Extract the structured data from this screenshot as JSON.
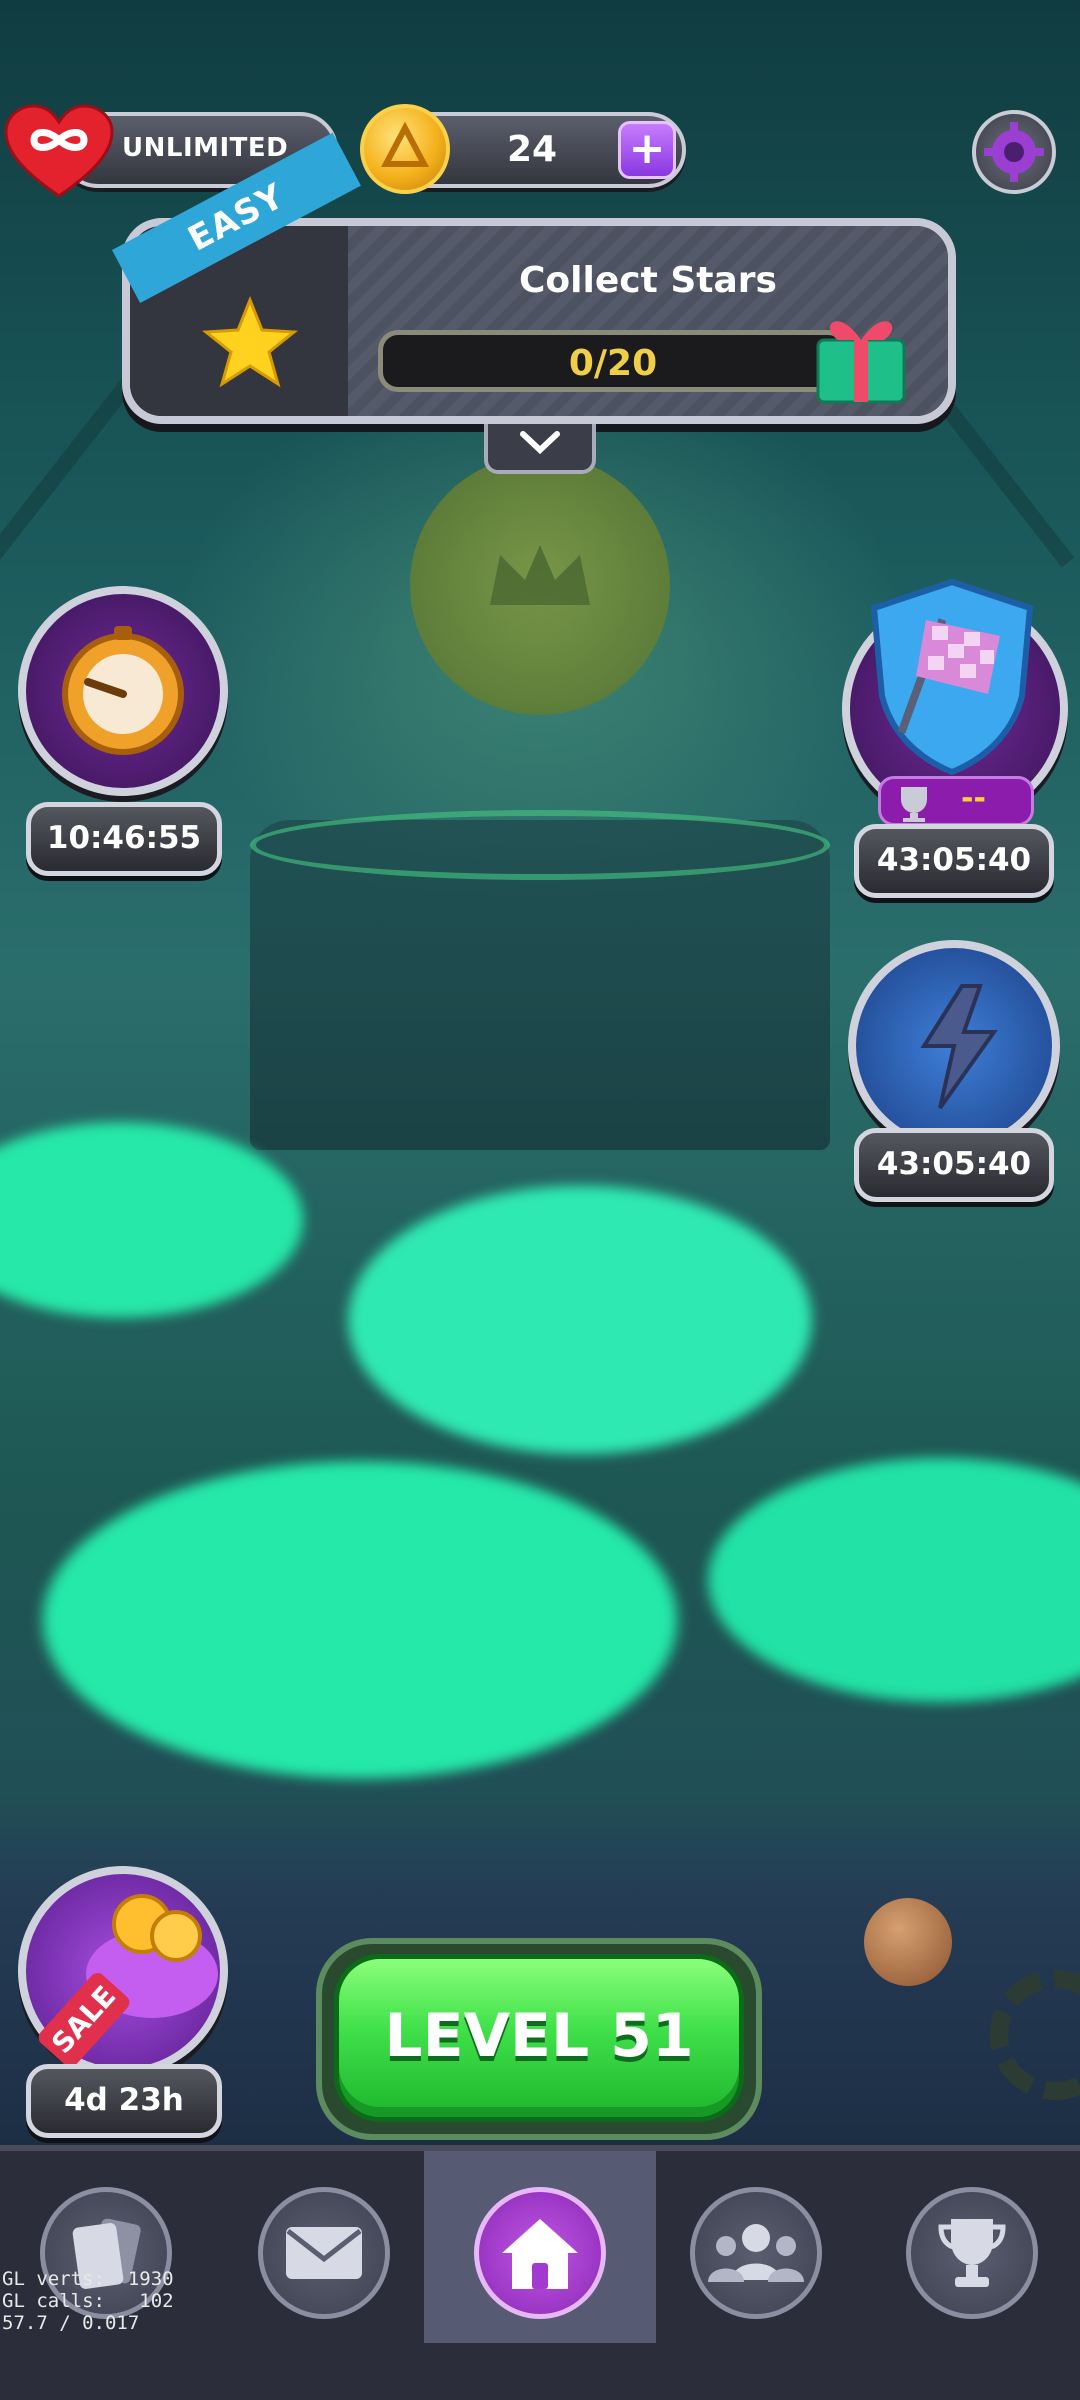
{
  "top_bar": {
    "lives_label": "UNLIMITED",
    "coin_count": "24",
    "add_coins_label": "+"
  },
  "quest": {
    "difficulty": "EASY",
    "title": "Collect Stars",
    "progress_text": "0/20",
    "progress_current": 0,
    "progress_total": 20
  },
  "events": {
    "left_timer": "10:46:55",
    "flag_timer": "43:05:40",
    "flag_rank": "--",
    "lightning_timer": "43:05:40",
    "sale_badge": "SALE",
    "sale_timer": "4d 23h"
  },
  "level_button": {
    "label": "LEVEL 51"
  },
  "nav": {
    "items": [
      "cards",
      "mail",
      "home",
      "team",
      "leaderboard"
    ],
    "active": "home"
  },
  "debug": {
    "line1": "GL verts:  1930",
    "line2": "GL calls:   102",
    "line3": "57.7 / 0.017"
  },
  "colors": {
    "accent_green": "#3fe04a",
    "active_nav": "#c257e6",
    "progress_text": "#f0cf48",
    "easy_ribbon": "#2ea6d8",
    "goo": "#26e8a8"
  }
}
